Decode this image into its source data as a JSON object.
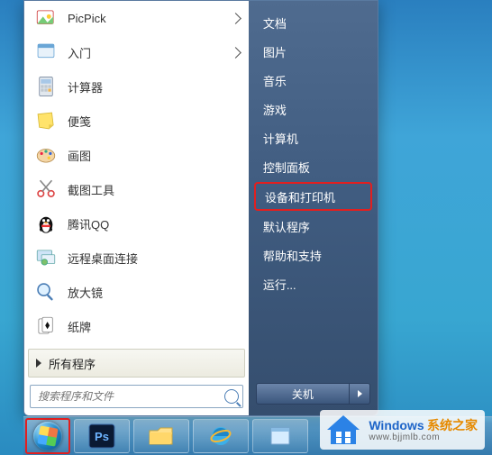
{
  "left_programs": [
    {
      "id": "picpick",
      "label": "PicPick",
      "has_arrow": true
    },
    {
      "id": "rumen",
      "label": "入门",
      "has_arrow": true
    },
    {
      "id": "calc",
      "label": "计算器",
      "has_arrow": false
    },
    {
      "id": "sticky",
      "label": "便笺",
      "has_arrow": false
    },
    {
      "id": "paint",
      "label": "画图",
      "has_arrow": false
    },
    {
      "id": "snip",
      "label": "截图工具",
      "has_arrow": false
    },
    {
      "id": "qq",
      "label": "腾讯QQ",
      "has_arrow": false
    },
    {
      "id": "rdp",
      "label": "远程桌面连接",
      "has_arrow": false
    },
    {
      "id": "magnify",
      "label": "放大镜",
      "has_arrow": false
    },
    {
      "id": "cards",
      "label": "纸牌",
      "has_arrow": false
    }
  ],
  "all_programs_label": "所有程序",
  "search_placeholder": "搜索程序和文件",
  "right_items": [
    {
      "label": "文档",
      "highlight": false
    },
    {
      "label": "图片",
      "highlight": false
    },
    {
      "label": "音乐",
      "highlight": false
    },
    {
      "label": "游戏",
      "highlight": false
    },
    {
      "label": "计算机",
      "highlight": false
    },
    {
      "label": "控制面板",
      "highlight": false
    },
    {
      "label": "设备和打印机",
      "highlight": true
    },
    {
      "label": "默认程序",
      "highlight": false
    },
    {
      "label": "帮助和支持",
      "highlight": false
    },
    {
      "label": "运行...",
      "highlight": false
    }
  ],
  "shutdown_label": "关机",
  "taskbar": [
    {
      "id": "start",
      "name": "start-button"
    },
    {
      "id": "ps",
      "name": "photoshop"
    },
    {
      "id": "explorer",
      "name": "file-explorer"
    },
    {
      "id": "ie",
      "name": "internet-explorer"
    },
    {
      "id": "notes",
      "name": "sticky-notes"
    }
  ],
  "watermark": {
    "brand": "Windows",
    "suffix": "系统之家",
    "url": "www.bjjmlb.com"
  }
}
